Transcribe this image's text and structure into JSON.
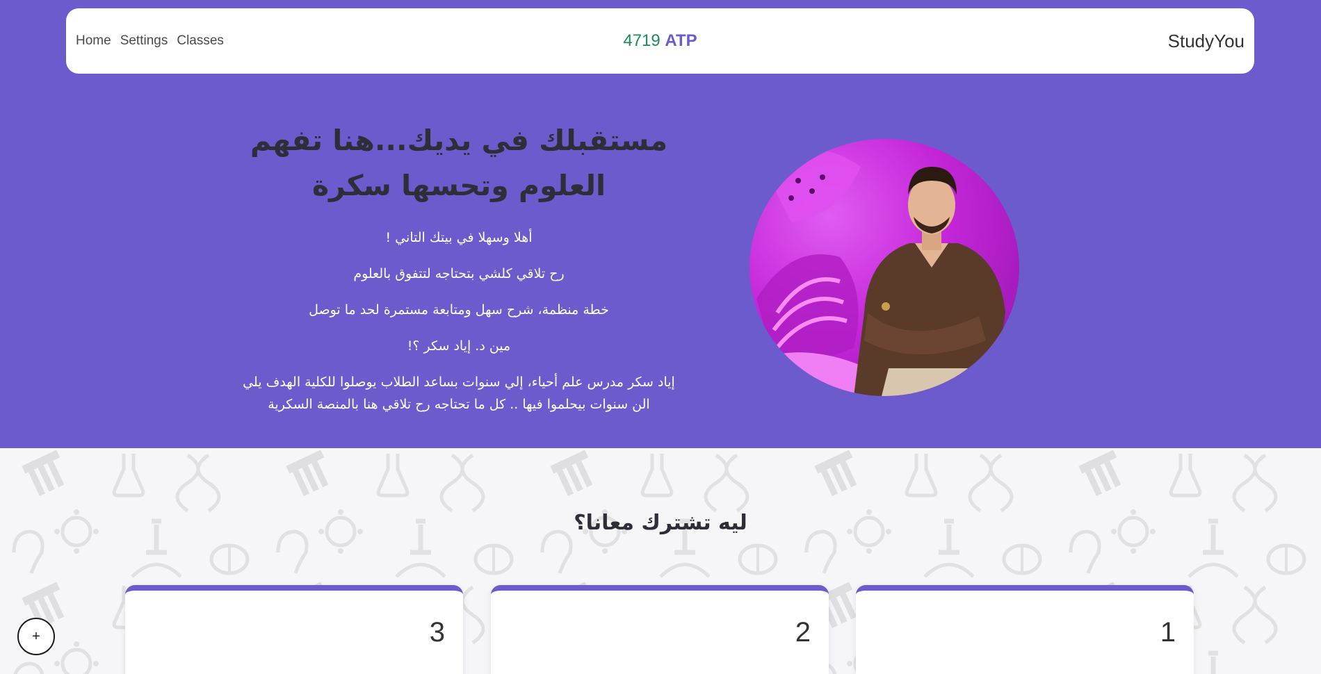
{
  "colors": {
    "accent": "#6b5bcd",
    "points_value": "#1f8a5a",
    "heading_dark": "#2e2e38"
  },
  "nav": {
    "links": [
      "Home",
      "Settings",
      "Classes"
    ],
    "points_value": "4719",
    "points_unit": "ATP",
    "brand": "StudyYou"
  },
  "hero": {
    "title": "مستقبلك في يديك...هنا تفهم العلوم وتحسها سكرة",
    "paragraphs": [
      "أهلا وسهلا في بيتك التاني !",
      "رح تلاقي كلشي بتحتاجه لتتفوق بالعلوم",
      "خطة منظمة، شرح سهل ومتابعة مستمرة لحد ما توصل",
      "مين د. إياد سكر ؟!",
      "إياد سكر مدرس علم أحياء، إلي سنوات بساعد الطلاب يوصلوا للكلية الهدف يلي الن سنوات بيحلموا فيها .. كل ما تحتاجه رح تلاقي هنا بالمنصة السكرية"
    ],
    "portrait_icon": "teacher-portrait"
  },
  "features": {
    "title": "ليه تشترك معانا؟",
    "cards": [
      {
        "number": "3"
      },
      {
        "number": "2"
      },
      {
        "number": "1"
      }
    ],
    "background_icons": [
      "microscope-icon",
      "flask-icon",
      "dna-icon",
      "virus-icon",
      "brain-icon",
      "ear-icon",
      "nose-icon",
      "test-tubes-icon"
    ]
  },
  "fab": {
    "label": "+",
    "icon": "plus-icon"
  }
}
